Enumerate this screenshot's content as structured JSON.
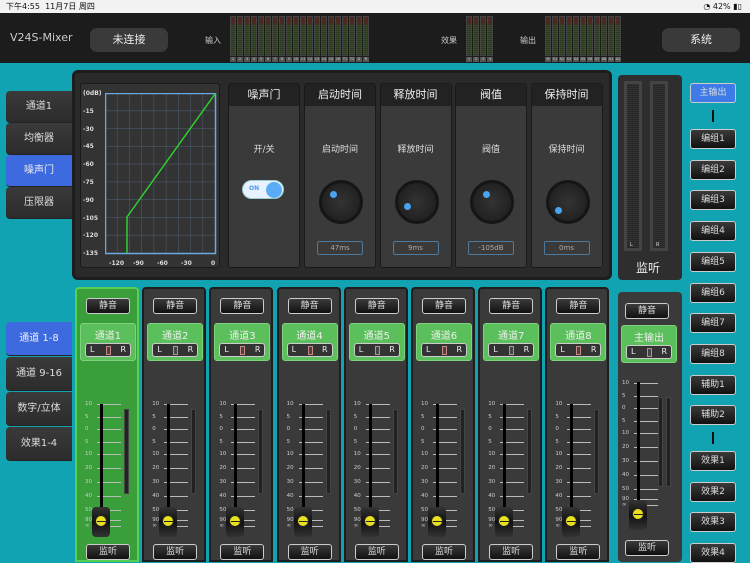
{
  "status": {
    "time": "下午4:55",
    "date": "11月7日 周四",
    "battery": "42%"
  },
  "header": {
    "title": "V24S-Mixer",
    "connect": "未连接",
    "system": "系统",
    "input_label": "输入",
    "fx_label": "效果",
    "output_label": "输出",
    "input_meters": [
      "1",
      "2",
      "3",
      "4",
      "5",
      "6",
      "7",
      "8",
      "9",
      "10",
      "11",
      "12",
      "13",
      "14",
      "15",
      "16",
      "T1",
      "T2",
      "D",
      "R"
    ],
    "fx_meters": [
      "1",
      "2",
      "3",
      "4"
    ],
    "output_meters": [
      "M",
      "S1",
      "S2",
      "S3",
      "S4",
      "S5",
      "S6",
      "S7",
      "S8",
      "A1",
      "A2"
    ]
  },
  "side_top": [
    {
      "label": "通道1",
      "active": false
    },
    {
      "label": "均衡器",
      "active": false
    },
    {
      "label": "噪声门",
      "active": true
    },
    {
      "label": "压限器",
      "active": false
    }
  ],
  "side_bottom": [
    {
      "label": "通道 1-8",
      "active": true
    },
    {
      "label": "通道 9-16",
      "active": false
    },
    {
      "label": "数字/立体",
      "active": false
    },
    {
      "label": "效果1-4",
      "active": false
    }
  ],
  "gate": {
    "y_ticks": [
      "(0dB)",
      "-15",
      "-30",
      "-45",
      "-60",
      "-75",
      "-90",
      "-105",
      "-120",
      "-135"
    ],
    "x_ticks": [
      "-120",
      "-90",
      "-60",
      "-30",
      "0"
    ],
    "switch": {
      "title": "噪声门",
      "label": "开/关",
      "state": "ON"
    },
    "params": [
      {
        "title": "启动时间",
        "label": "启动时间",
        "value": "47ms"
      },
      {
        "title": "释放时间",
        "label": "释放时间",
        "value": "9ms"
      },
      {
        "title": "阀值",
        "label": "阀值",
        "value": "-105dB"
      },
      {
        "title": "保持时间",
        "label": "保持时间",
        "value": "0ms"
      }
    ]
  },
  "strips": {
    "mute": "静音",
    "listen": "监听",
    "L": "L",
    "R": "R",
    "scale": [
      "10",
      "5",
      "0",
      "5",
      "10",
      "20",
      "30",
      "40",
      "50",
      "90",
      "∞"
    ],
    "channels": [
      "通道1",
      "通道2",
      "通道3",
      "通道4",
      "通道5",
      "通道6",
      "通道7",
      "通道8"
    ],
    "selected": 0
  },
  "monitor": {
    "label": "监听",
    "L": "L",
    "R": "R"
  },
  "master": {
    "name": "主输出",
    "mute": "静音",
    "listen": "监听"
  },
  "right": {
    "main": "主输出",
    "groups": [
      "编组1",
      "编组2",
      "编组3",
      "编组4",
      "编组5",
      "编组6",
      "编组7",
      "编组8",
      "辅助1",
      "辅助2"
    ],
    "fx": [
      "效果1",
      "效果2",
      "效果3",
      "效果4"
    ]
  }
}
